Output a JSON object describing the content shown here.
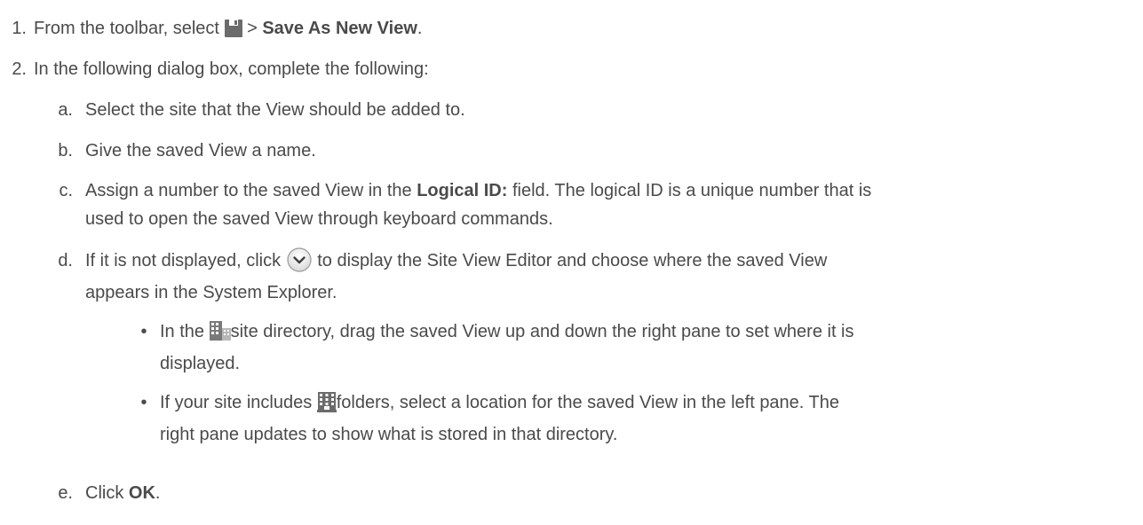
{
  "steps": [
    {
      "number": "1.",
      "pre": "From the toolbar, select ",
      "icon": "save-disk-icon",
      "mid": " > ",
      "bold": "Save As New View",
      "post": "."
    },
    {
      "number": "2.",
      "text": "In the following dialog box, complete the following:"
    }
  ],
  "substeps": {
    "a": {
      "letter": "a.",
      "text": "Select the site that the View should be added to."
    },
    "b": {
      "letter": "b.",
      "text": "Give the saved View a name."
    },
    "c": {
      "letter": "c.",
      "pre": "Assign a number to the saved View in the ",
      "bold": "Logical ID:",
      "post_line1": " field. The logical ID is a unique number that is",
      "line2": "used to open the saved View through keyboard commands."
    },
    "d": {
      "letter": "d.",
      "pre": "If it is not displayed, click ",
      "icon": "expand-chevron-circle-icon",
      "post_line1": " to display the Site View Editor and choose where the saved View",
      "line2": "appears in the System Explorer."
    },
    "e": {
      "letter": "e.",
      "pre": "Click ",
      "bold": "OK",
      "post": "."
    }
  },
  "bullets": [
    {
      "dot": "•",
      "pre": "In the ",
      "icon": "site-directory-icon",
      "post_line1": "site directory, drag the saved View up and down the right pane to set where it is",
      "line2": "displayed."
    },
    {
      "dot": "•",
      "pre": "If your site includes ",
      "icon": "folders-building-icon",
      "post_line1": "folders, select a location for the saved View in the left pane. The",
      "line2": "right pane updates to show what is stored in that directory."
    }
  ],
  "colors": {
    "text": "#4a4a4a",
    "icon": "#6b6b6b"
  }
}
